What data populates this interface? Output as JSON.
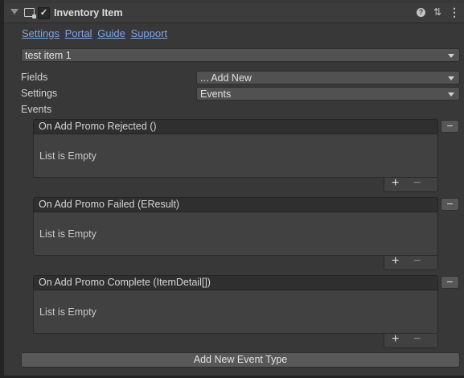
{
  "header": {
    "title": "Inventory Item",
    "checkbox_mark": "✓",
    "help_glyph": "?",
    "presets_glyph": "⇅",
    "menu_glyph": "⋮"
  },
  "links": [
    "Settings",
    "Portal",
    "Guide",
    "Support"
  ],
  "item_select": {
    "value": "test item 1"
  },
  "fields": {
    "label": "Fields",
    "value": "... Add New"
  },
  "settings": {
    "label": "Settings",
    "value": "Events"
  },
  "events_label": "Events",
  "events": [
    {
      "title": "On Add Promo Rejected ()",
      "empty_text": "List is Empty",
      "plus": "+",
      "minus": "−",
      "remove": "−"
    },
    {
      "title": "On Add Promo Failed (EResult)",
      "empty_text": "List is Empty",
      "plus": "+",
      "minus": "−",
      "remove": "−"
    },
    {
      "title": "On Add Promo Complete (ItemDetail[])",
      "empty_text": "List is Empty",
      "plus": "+",
      "minus": "−",
      "remove": "−"
    }
  ],
  "add_event_button": "Add New Event Type",
  "icons": {
    "foldout": "foldout-arrow-icon",
    "component": "component-icon",
    "help": "help-icon",
    "presets": "presets-icon",
    "menu": "kebab-menu-icon"
  },
  "colors": {
    "link": "#7ba8e6",
    "background": "#383838",
    "header": "#3c3c3c"
  }
}
